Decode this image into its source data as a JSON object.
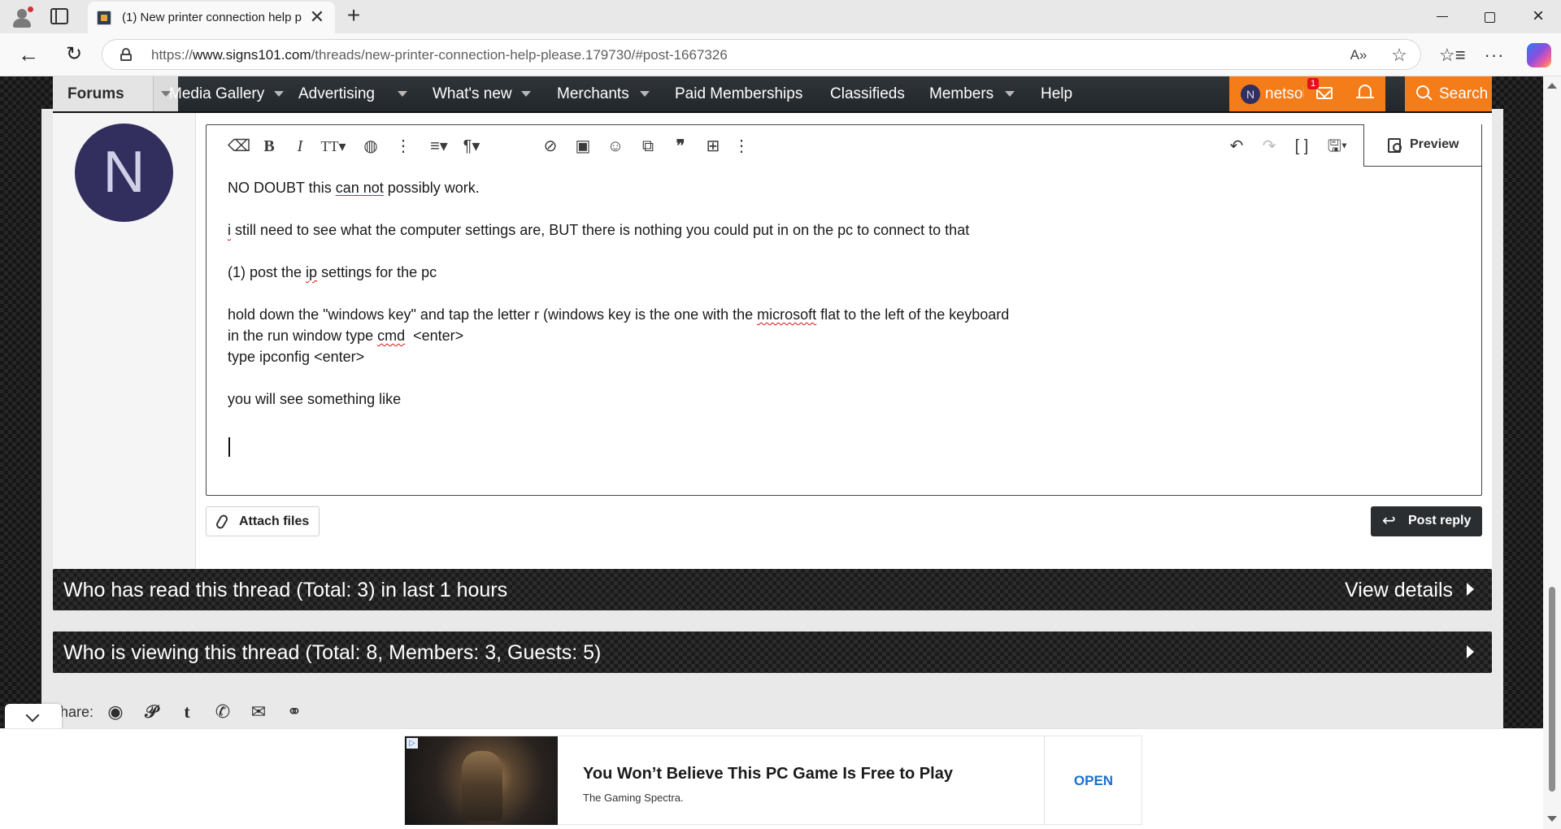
{
  "browser": {
    "tab_title": "(1) New printer connection help p",
    "tab_close": "✕",
    "new_tab": "+",
    "url_prefix": "https://",
    "url_host": "www.signs101.com",
    "url_path": "/threads/new-printer-connection-help-please.179730/#post-1667326",
    "icons": [
      "profile-icon",
      "tab-actions-icon",
      "back-icon",
      "reload-icon",
      "lock-icon",
      "read-aloud-icon",
      "favorite-star-icon",
      "favorites-icon",
      "more-icon",
      "copilot-icon",
      "minimize-icon",
      "maximize-icon",
      "close-icon"
    ]
  },
  "nav": {
    "forums": "Forums",
    "links": [
      {
        "label": "Media Gallery",
        "has_menu": true
      },
      {
        "label": "Advertising",
        "has_menu": true
      },
      {
        "label": "What's new",
        "has_menu": true
      },
      {
        "label": "Merchants",
        "has_menu": true
      },
      {
        "label": "Paid Memberships",
        "has_menu": false
      },
      {
        "label": "Classifieds",
        "has_menu": false
      },
      {
        "label": "Members",
        "has_menu": true
      },
      {
        "label": "Help",
        "has_menu": false
      }
    ],
    "user_initial": "N",
    "username": "netsol",
    "inbox_badge": "1",
    "search": "Search",
    "accent_color": "#f47c19"
  },
  "post": {
    "avatar_initial": "N",
    "avatar_color": "#322f5e"
  },
  "editor": {
    "toolbar_icons": [
      "eraser-icon",
      "bold-icon",
      "italic-icon",
      "text-size-icon",
      "palette-icon",
      "more-options-icon",
      "align-icon",
      "paragraph-icon",
      "link-icon",
      "image-icon",
      "smilie-icon",
      "media-icon",
      "quote-icon",
      "table-icon",
      "more-insert-icon",
      "undo-icon",
      "redo-icon",
      "bbcode-icon",
      "drafts-icon"
    ],
    "preview": "Preview",
    "lines": {
      "l1_a": "NO DOUBT this ",
      "l1_b": "can not",
      "l1_c": " possibly work.",
      "l2_a": "i",
      "l2_b": " still need to see what the computer settings are, BUT there is nothing you could put in on the pc to connect to that",
      "l3_a": "(1) post the ",
      "l3_b": "ip",
      "l3_c": " settings for the pc",
      "l4_a": "hold down the \"windows key\" and tap the letter r (windows key is the one with the ",
      "l4_b": "microsoft",
      "l4_c": " flat to the left of the keyboard",
      "l5_a": "in the run window type ",
      "l5_b": "cmd",
      "l5_c": "  <enter>",
      "l6": "type ipconfig <enter>",
      "l7": "you will see something like"
    },
    "attach_files": "Attach files",
    "post_reply": "Post reply"
  },
  "blocks": {
    "read_title": "Who has read this thread (Total: 3) in last 1 hours",
    "read_action": "View details",
    "viewing_title": "Who is viewing this thread (Total: 8, Members: 3, Guests: 5)"
  },
  "share": {
    "label": "hare:",
    "icons": [
      "reddit-icon",
      "pinterest-icon",
      "tumblr-icon",
      "whatsapp-icon",
      "email-icon",
      "link-icon"
    ]
  },
  "ad": {
    "title": "You Won’t Believe This PC Game Is Free to Play",
    "source": "The Gaming Spectra.",
    "cta": "OPEN"
  }
}
